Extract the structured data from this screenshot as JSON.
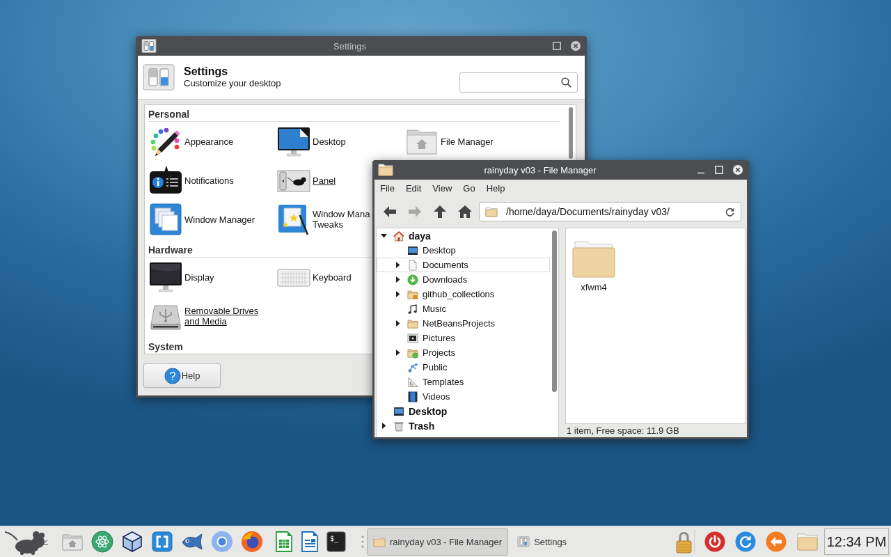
{
  "settings_window": {
    "title": "Settings",
    "focused": false,
    "header": {
      "title": "Settings",
      "subtitle": "Customize your desktop"
    },
    "sections": [
      {
        "title": "Personal",
        "rows": [
          [
            {
              "label": "Appearance",
              "kind": "appearance",
              "underlined": false
            },
            {
              "label": "Desktop",
              "kind": "desktop",
              "underlined": false
            },
            {
              "label": "File Manager",
              "kind": "filemanager",
              "underlined": false
            }
          ],
          [
            {
              "label": "Notifications",
              "kind": "notifications",
              "underlined": false
            },
            {
              "label": "Panel",
              "kind": "panel",
              "underlined": true
            }
          ],
          [
            {
              "label": "Window Manager",
              "kind": "windowmanager",
              "underlined": false
            },
            {
              "label": "Window Mana\nTweaks",
              "kind": "tweaks",
              "underlined": false
            }
          ]
        ]
      },
      {
        "title": "Hardware",
        "rows": [
          [
            {
              "label": "Display",
              "kind": "display",
              "underlined": false
            },
            {
              "label": "Keyboard",
              "kind": "keyboard",
              "underlined": false
            }
          ],
          [
            {
              "label": "Removable Drives\nand Media",
              "kind": "removable",
              "underlined": true
            }
          ]
        ]
      },
      {
        "title": "System"
      }
    ],
    "help_button": {
      "label": "Help",
      "icon_glyph": "?"
    }
  },
  "file_manager": {
    "title": "rainyday v03 - File Manager",
    "focused": true,
    "menu": [
      "File",
      "Edit",
      "View",
      "Go",
      "Help"
    ],
    "nav_buttons": [
      {
        "kind": "back",
        "disabled": false
      },
      {
        "kind": "forward",
        "disabled": true
      },
      {
        "kind": "up",
        "disabled": false
      },
      {
        "kind": "home",
        "disabled": false
      }
    ],
    "location": "/home/daya/Documents/rainyday v03/",
    "tree": [
      {
        "label": "daya",
        "kind": "home",
        "expandable": true,
        "expanded": true,
        "selected": false,
        "children": [
          {
            "label": "Desktop",
            "kind": "desktop",
            "expandable": false,
            "expanded": false,
            "selected": false
          },
          {
            "label": "Documents",
            "kind": "documents",
            "expandable": true,
            "expanded": false,
            "selected": true
          },
          {
            "label": "Downloads",
            "kind": "downloads",
            "expandable": true,
            "expanded": false,
            "selected": false
          },
          {
            "label": "github_collections",
            "kind": "repo",
            "expandable": true,
            "expanded": false,
            "selected": false
          },
          {
            "label": "Music",
            "kind": "music",
            "expandable": false,
            "expanded": false,
            "selected": false
          },
          {
            "label": "NetBeansProjects",
            "kind": "folder",
            "expandable": true,
            "expanded": false,
            "selected": false
          },
          {
            "label": "Pictures",
            "kind": "pictures",
            "expandable": false,
            "expanded": false,
            "selected": false
          },
          {
            "label": "Projects",
            "kind": "projects",
            "expandable": true,
            "expanded": false,
            "selected": false
          },
          {
            "label": "Public",
            "kind": "public",
            "expandable": false,
            "expanded": false,
            "selected": false
          },
          {
            "label": "Templates",
            "kind": "templates",
            "expandable": false,
            "expanded": false,
            "selected": false
          },
          {
            "label": "Videos",
            "kind": "videos",
            "expandable": false,
            "expanded": false,
            "selected": false
          }
        ]
      },
      {
        "label": "Desktop",
        "kind": "desktop",
        "expandable": false,
        "expanded": false,
        "selected": false
      },
      {
        "label": "Trash",
        "kind": "trash",
        "expandable": true,
        "expanded": false,
        "selected": false
      }
    ],
    "items": [
      {
        "label": "xfwm4"
      }
    ],
    "status_bar": "1 item, Free space: 11.9 GB"
  },
  "taskbar": {
    "terminal_prompt": "$_",
    "tasks": [
      {
        "label": "rainyday v03 - File Manager",
        "kind": "folder",
        "selected": true
      },
      {
        "label": "Settings",
        "kind": "settings",
        "selected": false
      }
    ],
    "clock": "12:34 PM"
  }
}
